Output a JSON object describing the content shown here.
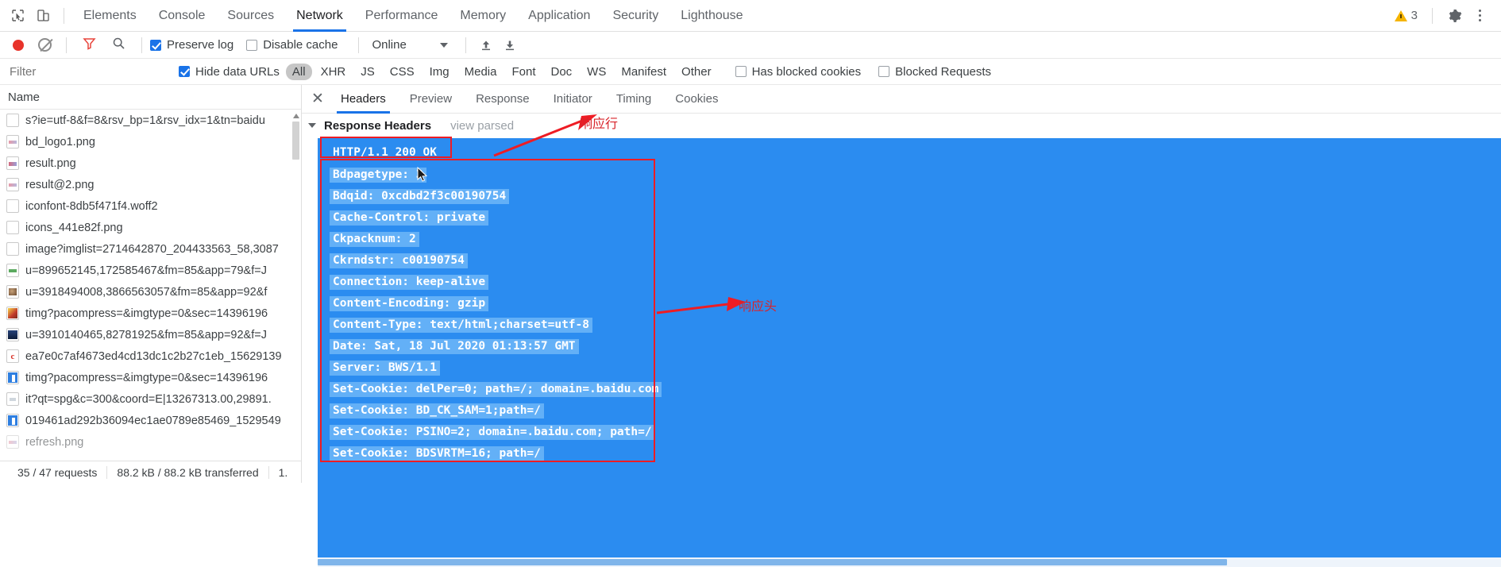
{
  "topbar": {
    "icons": [
      {
        "name": "inspect-element-icon"
      },
      {
        "name": "device-toolbar-icon"
      }
    ],
    "tabs": [
      {
        "label": "Elements",
        "active": false
      },
      {
        "label": "Console",
        "active": false
      },
      {
        "label": "Sources",
        "active": false
      },
      {
        "label": "Network",
        "active": true
      },
      {
        "label": "Performance",
        "active": false
      },
      {
        "label": "Memory",
        "active": false
      },
      {
        "label": "Application",
        "active": false
      },
      {
        "label": "Security",
        "active": false
      },
      {
        "label": "Lighthouse",
        "active": false
      }
    ],
    "warning_count": "3",
    "warning_icon": "warning-triangle-icon",
    "settings_icon": "gear-icon",
    "more_icon": "kebab-menu-icon"
  },
  "controls": {
    "record_icon": "record-button-icon",
    "clear_icon": "clear-icon",
    "filter_icon": "funnel-filter-icon",
    "search_icon": "search-icon",
    "preserve_log_label": "Preserve log",
    "preserve_log_checked": true,
    "disable_cache_label": "Disable cache",
    "disable_cache_checked": false,
    "throttle_value": "Online",
    "import_icon": "upload-har-icon",
    "export_icon": "download-har-icon"
  },
  "filterbar": {
    "filter_placeholder": "Filter",
    "filter_value": "",
    "hide_data_urls_label": "Hide data URLs",
    "hide_data_urls_checked": true,
    "types": [
      {
        "label": "All",
        "selected": true
      },
      {
        "label": "XHR",
        "selected": false
      },
      {
        "label": "JS",
        "selected": false
      },
      {
        "label": "CSS",
        "selected": false
      },
      {
        "label": "Img",
        "selected": false
      },
      {
        "label": "Media",
        "selected": false
      },
      {
        "label": "Font",
        "selected": false
      },
      {
        "label": "Doc",
        "selected": false
      },
      {
        "label": "WS",
        "selected": false
      },
      {
        "label": "Manifest",
        "selected": false
      },
      {
        "label": "Other",
        "selected": false
      }
    ],
    "has_blocked_cookies_label": "Has blocked cookies",
    "has_blocked_cookies_checked": false,
    "blocked_requests_label": "Blocked Requests",
    "blocked_requests_checked": false
  },
  "requests": {
    "column_header": "Name",
    "rows": [
      {
        "name": "s?ie=utf-8&f=8&rsv_bp=1&rsv_idx=1&tn=baidu",
        "icon": "document-icon",
        "icon_style": "doc"
      },
      {
        "name": "bd_logo1.png",
        "icon": "image-icon",
        "icon_style": "img-a"
      },
      {
        "name": "result.png",
        "icon": "image-icon",
        "icon_style": "img-b"
      },
      {
        "name": "result@2.png",
        "icon": "image-icon",
        "icon_style": "img-a"
      },
      {
        "name": "iconfont-8db5f471f4.woff2",
        "icon": "font-file-icon",
        "icon_style": "doc"
      },
      {
        "name": "icons_441e82f.png",
        "icon": "image-icon",
        "icon_style": "doc"
      },
      {
        "name": "image?imglist=2714642870_204433563_58,3087",
        "icon": "document-icon",
        "icon_style": "doc"
      },
      {
        "name": "u=899652145,172585467&fm=85&app=79&f=J",
        "icon": "image-icon",
        "icon_style": "green"
      },
      {
        "name": "u=3918494008,3866563057&fm=85&app=92&f",
        "icon": "image-icon",
        "icon_style": "brown"
      },
      {
        "name": "timg?pacompress=&imgtype=0&sec=14396196",
        "icon": "image-icon",
        "icon_style": "orange"
      },
      {
        "name": "u=3910140465,82781925&fm=85&app=92&f=J",
        "icon": "image-icon",
        "icon_style": "navy"
      },
      {
        "name": "ea7e0c7af4673ed4cd13dc1c2b27c1eb_15629139",
        "icon": "image-icon",
        "icon_style": "cred"
      },
      {
        "name": "timg?pacompress=&imgtype=0&sec=14396196",
        "icon": "image-icon",
        "icon_style": "blueglyph"
      },
      {
        "name": "it?qt=spg&c=300&coord=E|13267313.00,29891.",
        "icon": "image-icon",
        "icon_style": "faint"
      },
      {
        "name": "019461ad292b36094ec1ae0789e85469_1529549",
        "icon": "image-icon",
        "icon_style": "blueglyph"
      },
      {
        "name": "refresh.png",
        "icon": "image-icon",
        "icon_style": "doc"
      }
    ]
  },
  "statusbar": {
    "requests": "35 / 47 requests",
    "transferred": "88.2 kB / 88.2 kB transferred",
    "finish": "1."
  },
  "detail": {
    "close_icon": "close-icon",
    "tabs": [
      {
        "label": "Headers",
        "active": true
      },
      {
        "label": "Preview",
        "active": false
      },
      {
        "label": "Response",
        "active": false
      },
      {
        "label": "Initiator",
        "active": false
      },
      {
        "label": "Timing",
        "active": false
      },
      {
        "label": "Cookies",
        "active": false
      }
    ],
    "section_title": "Response Headers",
    "view_parsed": "view parsed",
    "status_line": "HTTP/1.1 200 OK",
    "headers": [
      "Bdpagetype: 3",
      "Bdqid: 0xcdbd2f3c00190754",
      "Cache-Control: private",
      "Ckpacknum: 2",
      "Ckrndstr: c00190754",
      "Connection: keep-alive",
      "Content-Encoding: gzip",
      "Content-Type: text/html;charset=utf-8",
      "Date: Sat, 18 Jul 2020 01:13:57 GMT",
      "Server: BWS/1.1",
      "Set-Cookie: delPer=0; path=/; domain=.baidu.com",
      "Set-Cookie: BD_CK_SAM=1;path=/",
      "Set-Cookie: PSINO=2; domain=.baidu.com; path=/",
      "Set-Cookie: BDSVRTM=16; path=/"
    ]
  },
  "annotations": {
    "status_line_label": "响应行",
    "headers_label": "响应头",
    "accent_red": "#ee1c24",
    "blue_bg": "#2b8cf0",
    "highlight_blue": "#63b0f7"
  }
}
